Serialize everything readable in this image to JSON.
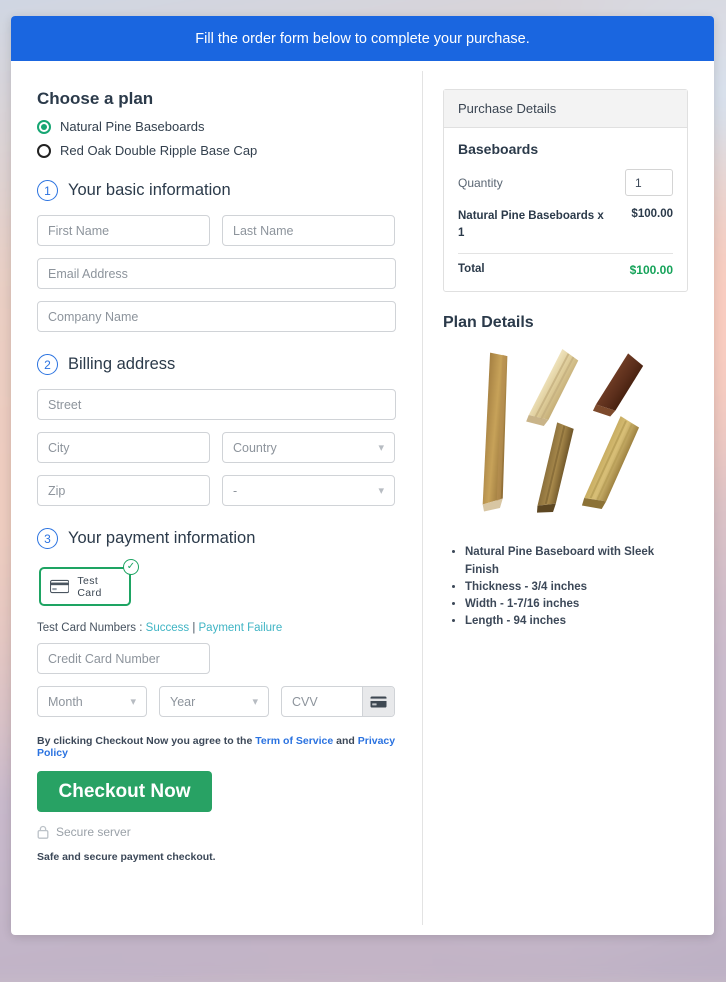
{
  "banner": {
    "text": "Fill the order form below to complete your purchase."
  },
  "plan": {
    "heading": "Choose a plan",
    "options": [
      {
        "label": "Natural Pine Baseboards",
        "selected": true
      },
      {
        "label": "Red Oak Double Ripple Base Cap",
        "selected": false
      }
    ]
  },
  "basic": {
    "step": "1",
    "title": "Your basic information",
    "first_name_placeholder": "First Name",
    "last_name_placeholder": "Last Name",
    "email_placeholder": "Email Address",
    "company_placeholder": "Company Name"
  },
  "billing": {
    "step": "2",
    "title": "Billing address",
    "street_placeholder": "Street",
    "city_placeholder": "City",
    "country_value": "Country",
    "zip_placeholder": "Zip",
    "state_value": "-"
  },
  "payment": {
    "step": "3",
    "title": "Your payment information",
    "method_label": "Test  Card",
    "method_selected": true,
    "test_prefix": "Test Card Numbers : ",
    "test_success": "Success",
    "test_divider": " | ",
    "test_failure": "Payment Failure",
    "card_number_placeholder": "Credit Card Number",
    "month_value": "Month",
    "year_value": "Year",
    "cvv_placeholder": "CVV"
  },
  "checkout": {
    "terms_prefix": "By clicking Checkout Now you agree to the ",
    "terms_link": "Term of Service",
    "terms_and": " and ",
    "privacy_link": "Privacy Policy",
    "button_label": "Checkout Now",
    "secure_label": "Secure server",
    "safe_note": "Safe and secure payment checkout."
  },
  "purchase": {
    "header": "Purchase Details",
    "group_title": "Baseboards",
    "quantity_label": "Quantity",
    "quantity_value": "1",
    "line_item_name": "Natural Pine Baseboards x 1",
    "line_item_amount": "$100.00",
    "total_label": "Total",
    "total_amount": "$100.00"
  },
  "plan_details": {
    "heading": "Plan Details",
    "specs": [
      "Natural Pine Baseboard with Sleek Finish",
      "Thickness - 3/4 inches",
      "Width - 1-7/16 inches",
      "Length - 94 inches"
    ]
  },
  "colors": {
    "banner_blue": "#1a66e0",
    "accent_blue": "#2a72e0",
    "green": "#28a264",
    "green_total": "#16a35a",
    "teal_link": "#3fb4c4"
  }
}
